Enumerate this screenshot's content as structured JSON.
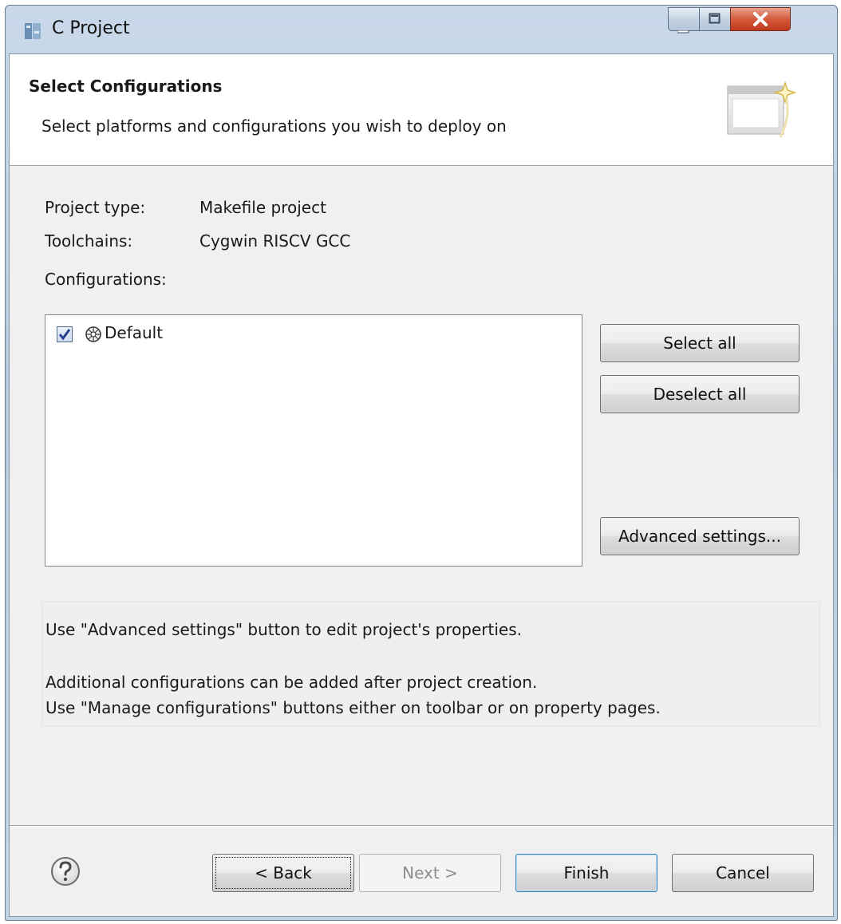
{
  "window": {
    "title": "C Project",
    "app_icon": "eclipse-app-icon",
    "controls": {
      "minimize_icon": "minimize-icon",
      "maximize_icon": "maximize-icon",
      "close_icon": "close-icon"
    }
  },
  "header": {
    "title": "Select Configurations",
    "description": "Select platforms and configurations you wish to deploy on",
    "image_icon": "wizard-banner-icon"
  },
  "project_info": {
    "project_type_label": "Project type:",
    "project_type_value": "Makefile project",
    "toolchains_label": "Toolchains:",
    "toolchains_value": "Cygwin RISCV GCC",
    "configurations_label": "Configurations:"
  },
  "configurations": {
    "items": [
      {
        "label": "Default",
        "checked": true,
        "icon": "configuration-icon"
      }
    ]
  },
  "side_buttons": {
    "select_all": "Select all",
    "deselect_all": "Deselect all",
    "advanced_settings": "Advanced settings..."
  },
  "info_panel": {
    "line1": "Use \"Advanced settings\" button to edit project's properties.",
    "line2": "Additional configurations can be added after project creation.",
    "line3": "Use \"Manage configurations\" buttons either on toolbar or on property pages."
  },
  "footer": {
    "help_icon": "help-icon",
    "back": "< Back",
    "next": "Next >",
    "finish": "Finish",
    "cancel": "Cancel"
  }
}
